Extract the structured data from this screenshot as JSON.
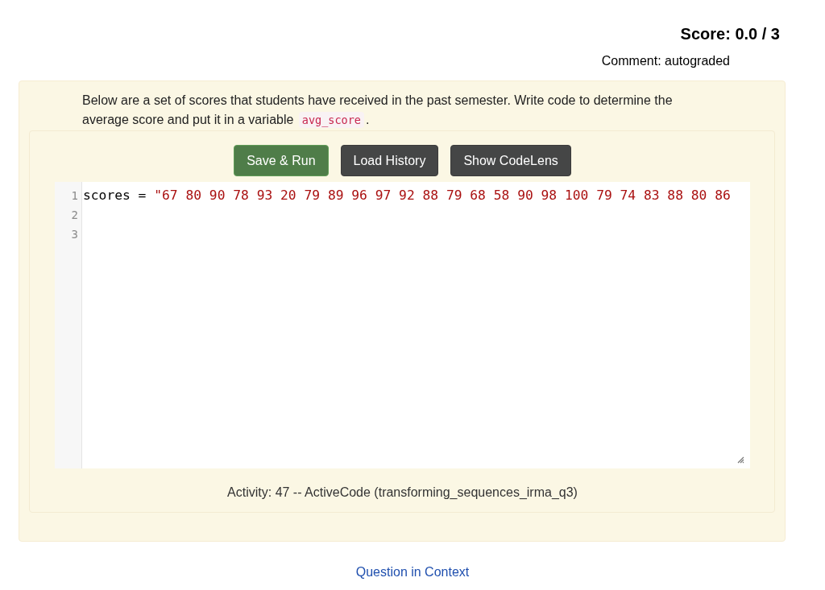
{
  "grade": {
    "score": "Score: 0.0 / 3",
    "comment": "Comment: autograded"
  },
  "question": {
    "parts": [
      {
        "kind": "text",
        "text": "Below are a set of scores that students have received in the past semester. Write code to determine the average score and put it in a variable "
      },
      {
        "kind": "code",
        "text": "avg_score"
      },
      {
        "kind": "text",
        "text": "."
      }
    ]
  },
  "toolbar": {
    "buttons": [
      {
        "label": "Save & Run",
        "kind": "primary"
      },
      {
        "label": "Load History",
        "kind": "secondary"
      },
      {
        "label": "Show CodeLens",
        "kind": "secondary"
      }
    ]
  },
  "editor": {
    "lines": [
      {
        "number": "1",
        "tokens": [
          {
            "kind": "plain",
            "text": "scores = "
          },
          {
            "kind": "string",
            "text": "\"67 80 90 78 93 20 79 89 96 97 92 88 79 68 58 90 98 100 79 74 83 88 80 86"
          }
        ]
      },
      {
        "number": "2"
      },
      {
        "number": "3"
      }
    ]
  },
  "activity_label": "Activity: 47 -- ActiveCode (transforming_sequences_irma_q3)",
  "link": "Question in Context"
}
